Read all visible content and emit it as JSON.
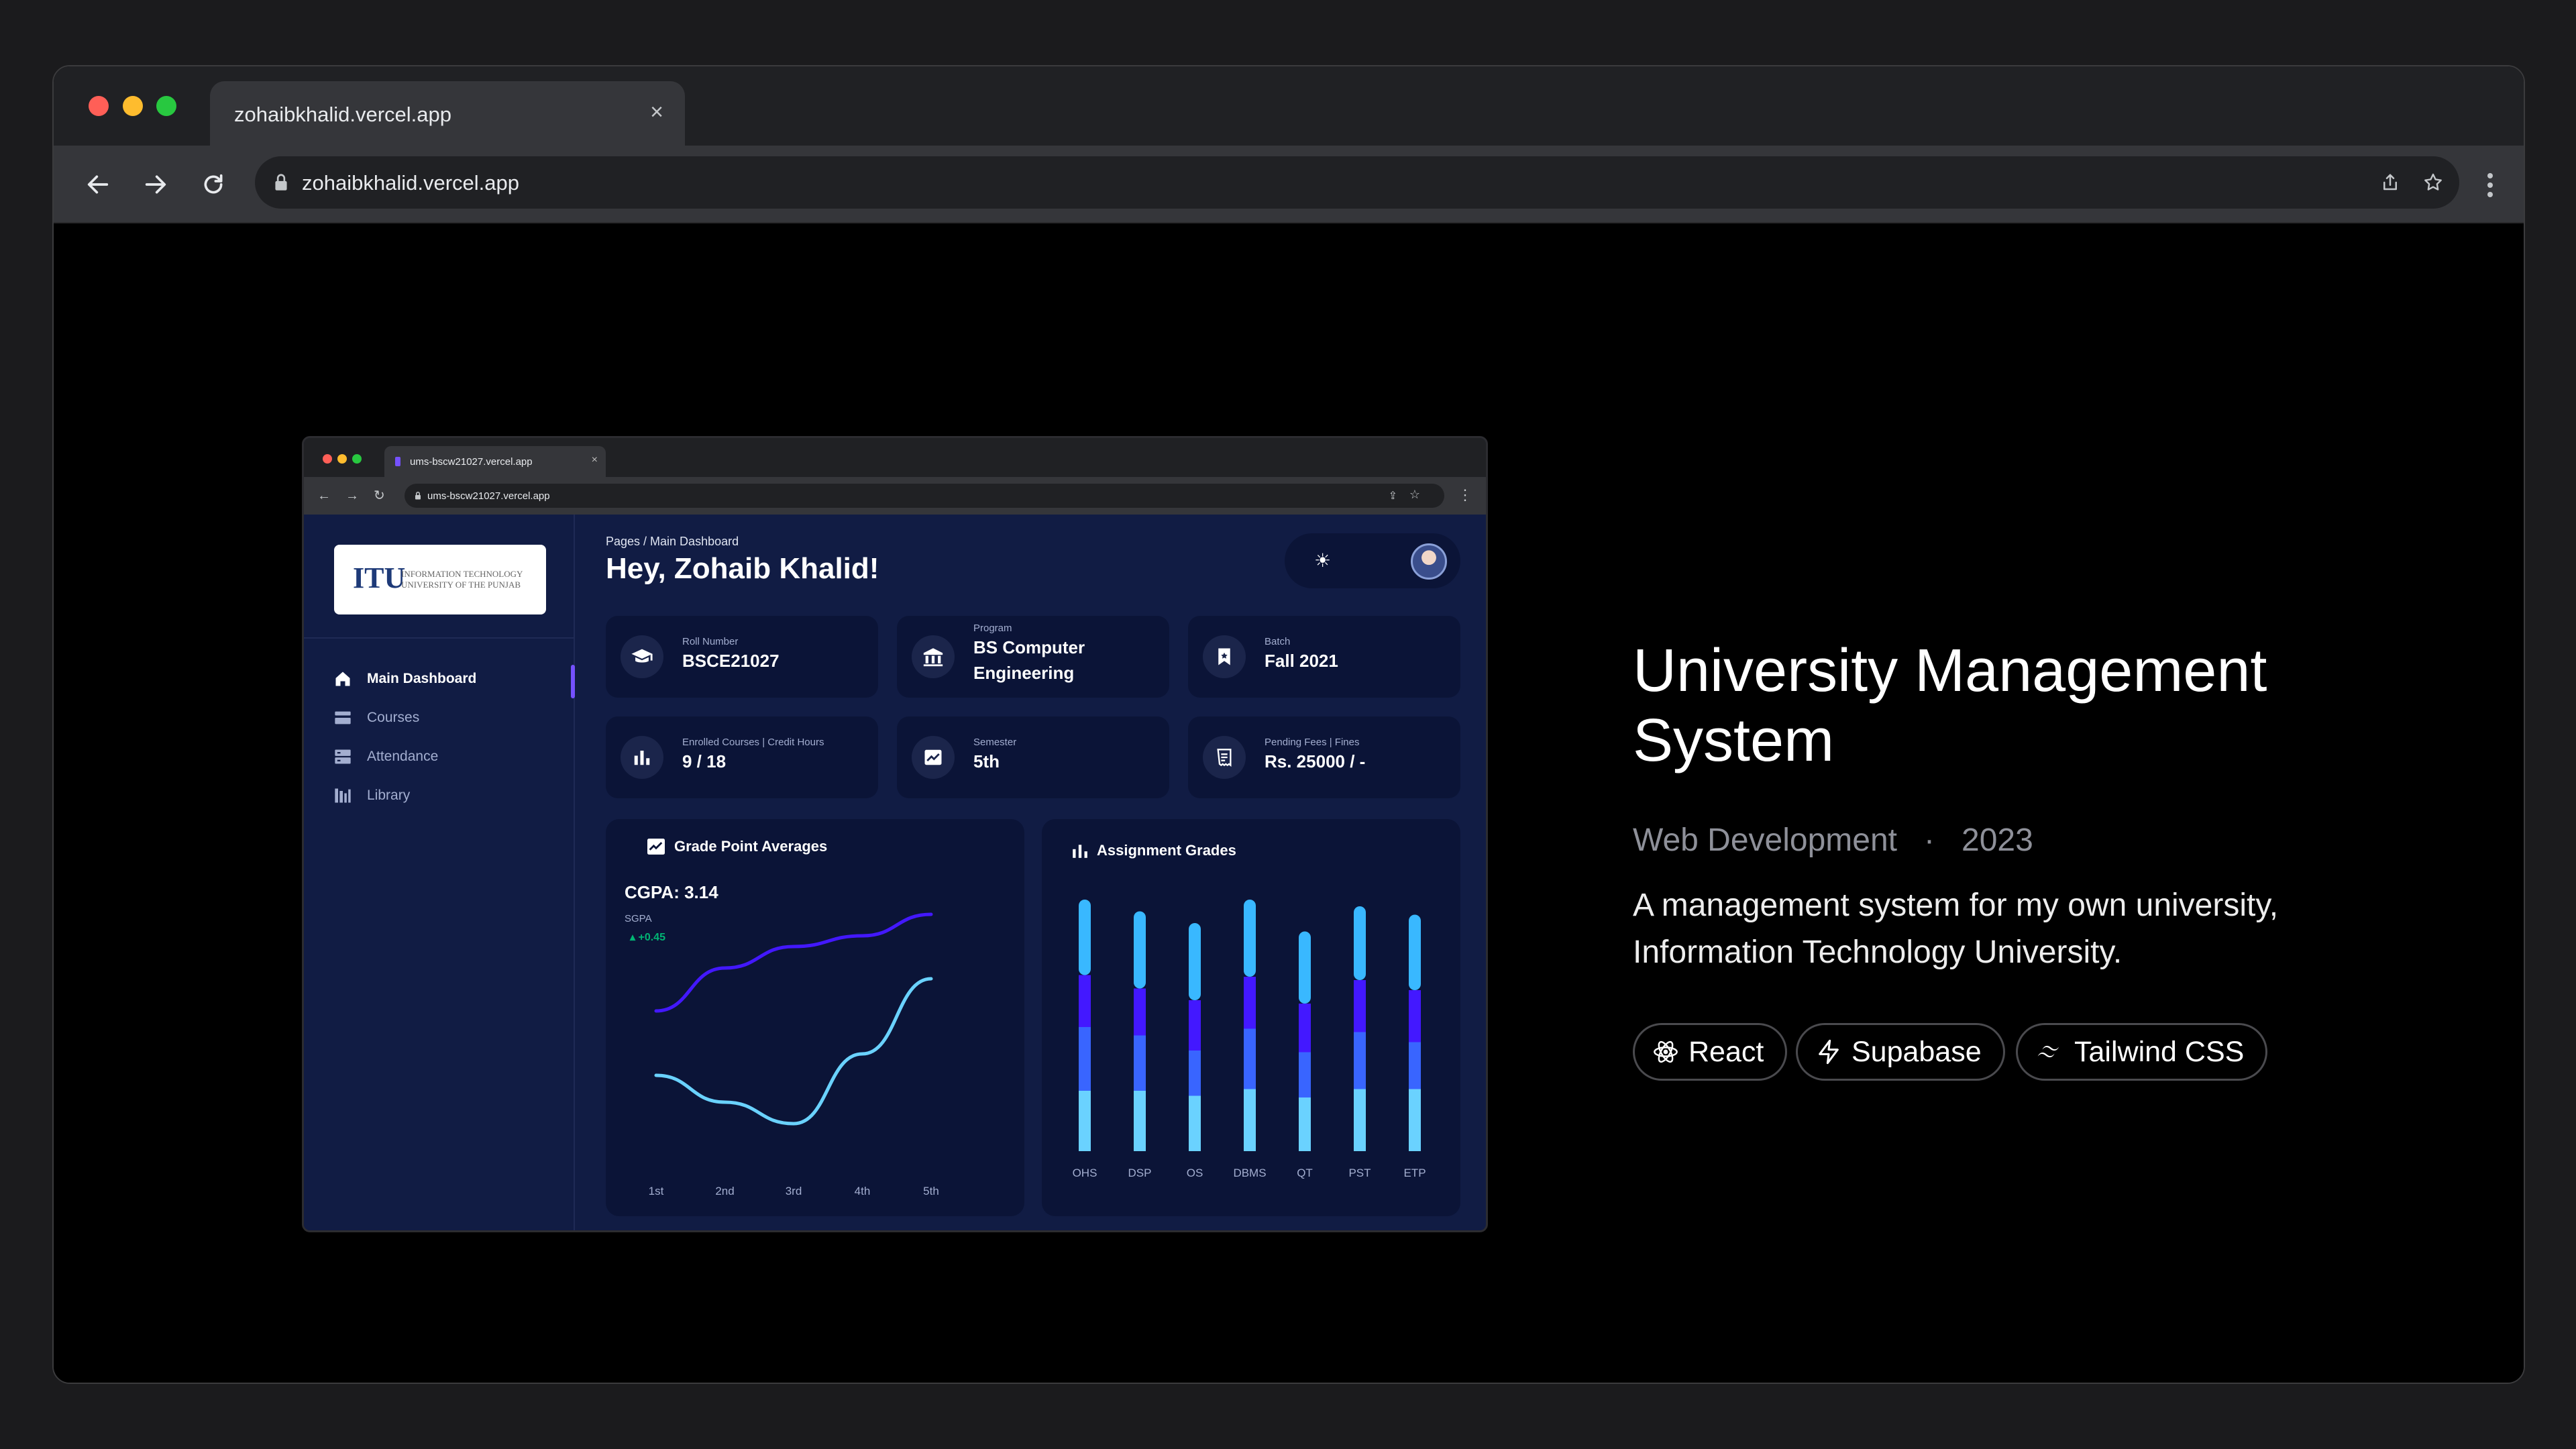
{
  "browser": {
    "tab_title": "zohaibkhalid.vercel.app",
    "url": "zohaibkhalid.vercel.app"
  },
  "project": {
    "title": "University Management System",
    "category": "Web Development",
    "year": "2023",
    "separator": "·",
    "description": "A management system for my own university, Information Technology University.",
    "tags": [
      {
        "label": "React",
        "icon": "react-icon"
      },
      {
        "label": "Supabase",
        "icon": "supabase-icon"
      },
      {
        "label": "Tailwind CSS",
        "icon": "tailwind-icon"
      }
    ]
  },
  "mock": {
    "tab_title": "ums-bscw21027.vercel.app",
    "url": "ums-bscw21027.vercel.app",
    "logo_mark": "ITU",
    "logo_text": "INFORMATION TECHNOLOGY UNIVERSITY OF THE PUNJAB",
    "sidebar": [
      {
        "label": "Main Dashboard",
        "icon": "home-icon"
      },
      {
        "label": "Courses",
        "icon": "courses-icon"
      },
      {
        "label": "Attendance",
        "icon": "attendance-icon"
      },
      {
        "label": "Library",
        "icon": "library-icon"
      }
    ],
    "breadcrumb": "Pages  /  Main Dashboard",
    "greeting": "Hey, Zohaib Khalid!",
    "cards": [
      {
        "label": "Roll Number",
        "value": "BSCE21027",
        "icon": "graduation-cap-icon"
      },
      {
        "label": "Program",
        "value": "BS Computer Engineering",
        "icon": "building-icon"
      },
      {
        "label": "Batch",
        "value": "Fall 2021",
        "icon": "bookmark-icon"
      },
      {
        "label": "Enrolled Courses | Credit Hours",
        "value": "9 / 18",
        "icon": "bar-chart-icon"
      },
      {
        "label": "Semester",
        "value": "5th",
        "icon": "chart-line-icon"
      },
      {
        "label": "Pending Fees | Fines",
        "value": "Rs. 25000 / -",
        "icon": "receipt-icon"
      }
    ],
    "gpa_card": {
      "title": "Grade Point Averages",
      "cgpa": "CGPA: 3.14",
      "sgpa_label": "SGPA",
      "delta": "+0.45"
    },
    "grades_card": {
      "title": "Assignment Grades"
    }
  },
  "chart_data": [
    {
      "type": "line",
      "title": "Grade Point Averages",
      "x": [
        "1st",
        "2nd",
        "3rd",
        "4th",
        "5th"
      ],
      "series": [
        {
          "values": [
            2.9,
            3.3,
            3.5,
            3.6,
            3.8
          ],
          "color": "#4318ff"
        },
        {
          "values": [
            2.3,
            2.05,
            1.85,
            2.5,
            3.2
          ],
          "color": "#6ad2ff"
        }
      ],
      "ylim": [
        1.5,
        4.0
      ]
    },
    {
      "type": "bar",
      "title": "Assignment Grades",
      "categories": [
        "OHS",
        "DSP",
        "OS",
        "DBMS",
        "QT",
        "PST",
        "ETP"
      ],
      "series": [
        {
          "values": [
            36,
            36,
            33,
            37,
            32,
            37,
            37
          ],
          "color": "#6ad2ff"
        },
        {
          "values": [
            38,
            33,
            27,
            36,
            27,
            34,
            28
          ],
          "color": "#3965ff"
        },
        {
          "values": [
            31,
            28,
            30,
            31,
            29,
            31,
            31
          ],
          "color": "#4318ff"
        },
        {
          "values": [
            45,
            46,
            46,
            46,
            43,
            44,
            45
          ],
          "color": "#39b8ff"
        }
      ],
      "ylim": [
        0,
        150
      ]
    }
  ]
}
